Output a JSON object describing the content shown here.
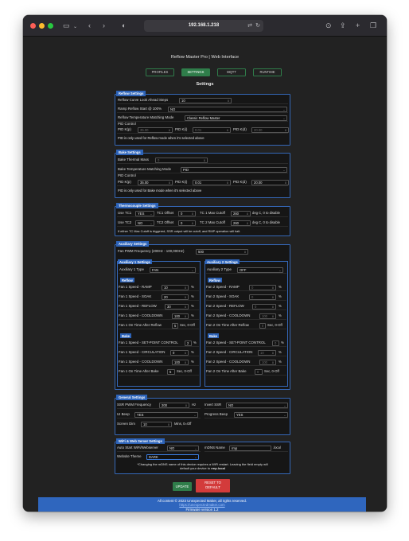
{
  "browser": {
    "url": "192.168.1.218"
  },
  "app": {
    "title": "Reflow Master Pro | Web Interface",
    "tabs": [
      "PROFILES",
      "SETTINGS",
      "MQTT",
      "RUNTIME"
    ],
    "active_tab": "SETTINGS",
    "page_heading": "Settings"
  },
  "reflow": {
    "title": "Reflow Settings",
    "lookahead_label": "Reflow Curve Look Ahead Steps",
    "lookahead_value": "10",
    "ramp_label": "Ramp Reflow Start @ 100%",
    "ramp_value": "NO",
    "matching_label": "Reflow Temperature Matching Mode",
    "matching_value": "Classic Reflow Master",
    "pid_heading": "PID Control",
    "pid_kp_label": "PID K(p)",
    "pid_kp_value": "35.00",
    "pid_ki_label": "PID K(i)",
    "pid_ki_value": "0.01",
    "pid_kd_label": "PID K(d)",
    "pid_kd_value": "20.00",
    "note": "PID is only used for Reflow mode when it's selected above"
  },
  "bake": {
    "title": "Bake Settings",
    "mass_label": "Bake Thermal Mass",
    "mass_value": "0",
    "matching_label": "Bake Temperature Matching Mode",
    "matching_value": "PID",
    "pid_heading": "PID Control",
    "pid_kp_label": "PID K(p)",
    "pid_kp_value": "35.00",
    "pid_ki_label": "PID K(i)",
    "pid_ki_value": "0.01",
    "pid_kd_label": "PID K(d)",
    "pid_kd_value": "20.00",
    "note": "PID is only used for Bake mode when it's selected above"
  },
  "thermo": {
    "title": "Thermocouple Settings",
    "use_tc1_label": "Use TC1",
    "use_tc1_value": "YES",
    "tc1_offset_label": "TC1 Offset",
    "tc1_offset_value": "0",
    "tc1_cutoff_label": "TC 1 Max Cutoff",
    "tc1_cutoff_value": "260",
    "tc1_cutoff_unit": "deg C, 0 to disable",
    "use_tc2_label": "Use TC2",
    "use_tc2_value": "NO",
    "tc2_offset_label": "TC2 Offset",
    "tc2_offset_value": "0",
    "tc2_cutoff_label": "TC 2 Max Cutoff",
    "tc2_cutoff_value": "260",
    "tc2_cutoff_unit": "deg C, 0 to disable",
    "note": "If either TC Max Cutoff is triggered, SSR output will be cutoff, and RMP operation will halt."
  },
  "aux": {
    "title": "Auxiliary Settings",
    "pwm_label": "Fan PWM Frequency (200Hz - 100,000Hz)",
    "pwm_value": "500",
    "aux1": {
      "title": "Auxiliary 1 Settings",
      "type_label": "Auxiliary 1 Type",
      "type_value": "FAN",
      "reflow_tag": "Reflow",
      "ramp_label": "Fan 1 Speed - RAMP",
      "ramp_value": "10",
      "soak_label": "Fan 1 Speed - SOAK",
      "soak_value": "20",
      "reflow_label": "Fan 1 Speed - REFLOW",
      "reflow_value": "30",
      "cooldown_label": "Fan 1 Speed - COOLDOWN",
      "cooldown_value": "100",
      "on_after_reflow_label": "Fan 1 On Time After Reflow",
      "on_after_reflow_value": "5",
      "bake_tag": "Bake",
      "setpoint_label": "Fan 1 Speed - SET-POINT CONTROL",
      "setpoint_value": "2",
      "circ_label": "Fan 1 Speed - CIRCULATION",
      "circ_value": "0",
      "bake_cool_label": "Fan 1 Speed - COOLDOWN",
      "bake_cool_value": "100",
      "on_after_bake_label": "Fan 1 On Time After Bake",
      "on_after_bake_value": "5",
      "unit_pct": "%",
      "unit_sec": "Sec, 0-Off"
    },
    "aux2": {
      "title": "Auxiliary 2 Settings",
      "type_label": "Auxiliary 2 Type",
      "type_value": "OFF",
      "reflow_tag": "Reflow",
      "ramp_label": "Fan 2 Speed - RAMP",
      "ramp_value": "0",
      "soak_label": "Fan 2 Speed - SOAK",
      "soak_value": "0",
      "reflow_label": "Fan 2 Speed - REFLOW",
      "reflow_value": "0",
      "cooldown_label": "Fan 2 Speed - COOLDOWN",
      "cooldown_value": "100",
      "on_after_reflow_label": "Fan 2 On Time After Reflow",
      "on_after_reflow_value": "0",
      "bake_tag": "Bake",
      "setpoint_label": "Fan 2 Speed - SET-POINT CONTROL",
      "setpoint_value": "0",
      "circ_label": "Fan 2 Speed - CIRCULATION",
      "circ_value": "10",
      "bake_cool_label": "Fan 2 Speed - COOLDOWN",
      "bake_cool_value": "100",
      "on_after_bake_label": "Fan 2 On Time After Bake",
      "on_after_bake_value": "0",
      "unit_pct": "%",
      "unit_sec": "Sec, 0-Off"
    }
  },
  "general": {
    "title": "General Settings",
    "ssr_label": "SSR PWM Frequency",
    "ssr_value": "200",
    "ssr_unit": "Hz",
    "invert_label": "Invert SSR",
    "invert_value": "NO",
    "beep_label": "UI Beep",
    "beep_value": "YES",
    "progress_label": "Progress Beep",
    "progress_value": "YES",
    "dim_label": "Screen Dim",
    "dim_value": "10",
    "dim_unit": "Mins, 0=Off"
  },
  "wifi": {
    "title": "WiFi & Web Server Settings",
    "autostart_label": "Auto Start WiFi/Webserver",
    "autostart_value": "NO",
    "mdns_label": "mDNS Name",
    "mdns_value": "rmp",
    "mdns_suffix": ".local",
    "theme_label": "Website Theme",
    "theme_value": "DARK",
    "note_line1": "*Changing the mDNS name of this device requires a WiFi restart. Leaving the field empty will",
    "note_line2_prefix": "default your device to ",
    "note_line2_bold": "rmp.local"
  },
  "actions": {
    "update_label": "UPDATE",
    "reset_label_1": "RESET TO",
    "reset_label_2": "DEFAULT"
  },
  "footer": {
    "line1": "All content © 2023 Unexpected Maker, all rights reserved.",
    "line2": "https://unexpectedmaker.com",
    "line3": "Firmware version 1.2"
  }
}
